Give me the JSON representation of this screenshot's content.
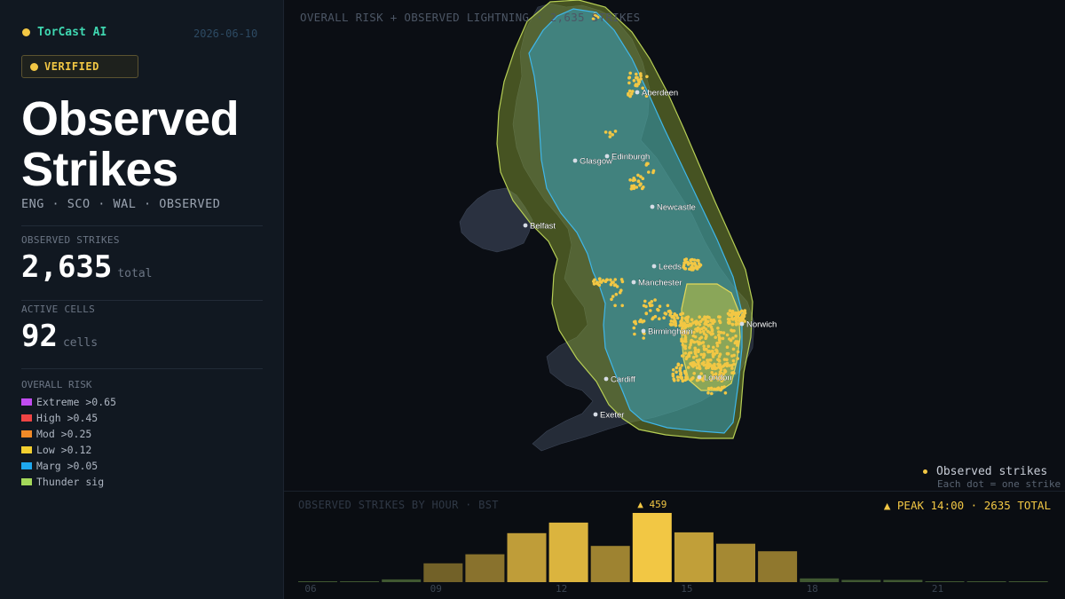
{
  "brand": {
    "name": "TorCast AI",
    "date": "2026-06-10"
  },
  "badge": {
    "label": "VERIFIED"
  },
  "title": {
    "line1": "Observed",
    "line2": "Strikes"
  },
  "subtitle": "ENG · SCO · WAL · OBSERVED",
  "stats": {
    "strikes_label": "OBSERVED STRIKES",
    "strikes_value": "2,635",
    "strikes_unit": "total",
    "cells_label": "ACTIVE CELLS",
    "cells_value": "92",
    "cells_unit": "cells"
  },
  "legend": {
    "title": "OVERALL RISK",
    "items": [
      {
        "label": "Extreme >0.65",
        "color": "#c04cf0"
      },
      {
        "label": "High >0.45",
        "color": "#ee4444"
      },
      {
        "label": "Mod >0.25",
        "color": "#f08a28"
      },
      {
        "label": "Low >0.12",
        "color": "#f2cf30"
      },
      {
        "label": "Marg >0.05",
        "color": "#1ea7ee"
      },
      {
        "label": "Thunder sig",
        "color": "#a4d85a"
      }
    ]
  },
  "map": {
    "header": "OVERALL RISK + OBSERVED LIGHTNING · 2,635 STRIKES",
    "cities": [
      "Aberdeen",
      "Edinburgh",
      "Glasgow",
      "Newcastle",
      "Belfast",
      "Leeds",
      "Manchester",
      "Norwich",
      "Birmingham",
      "Cardiff",
      "London",
      "Exeter"
    ],
    "legend_label": "Observed strikes",
    "legend_sub": "Each dot = one strike"
  },
  "histogram": {
    "title": "OBSERVED STRIKES BY HOUR · BST",
    "peak_text": "▲ PEAK 14:00  ·  2635 TOTAL",
    "peak_label": "▲ 459",
    "tick_labels": [
      "06",
      "09",
      "12",
      "15",
      "18",
      "21"
    ]
  },
  "chart_data": {
    "type": "bar",
    "title": "OBSERVED STRIKES BY HOUR · BST",
    "categories": [
      "06",
      "07",
      "08",
      "09",
      "10",
      "11",
      "12",
      "13",
      "14",
      "15",
      "16",
      "17",
      "18",
      "19",
      "20",
      "21",
      "22",
      "23"
    ],
    "values": [
      2,
      2,
      18,
      125,
      185,
      325,
      395,
      240,
      459,
      330,
      255,
      205,
      25,
      15,
      15,
      2,
      2,
      2
    ],
    "ylim": [
      0,
      459
    ],
    "peak": {
      "hour": "14:00",
      "value": 459
    },
    "total": 2635,
    "color": "#f2c744"
  }
}
